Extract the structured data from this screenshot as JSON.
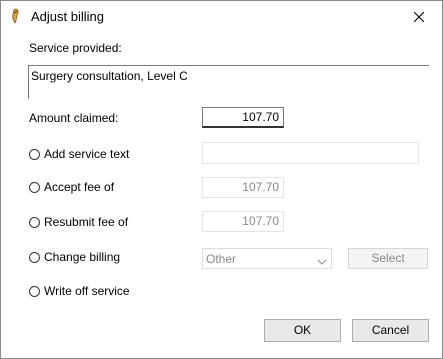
{
  "window": {
    "title": "Adjust billing"
  },
  "service": {
    "label": "Service provided:",
    "value": "Surgery consultation, Level C"
  },
  "amount": {
    "label": "Amount claimed:",
    "value": "107.70"
  },
  "options": {
    "add_text_label": "Add service text",
    "add_text_value": "",
    "accept_label": "Accept fee of",
    "accept_value": "107.70",
    "resubmit_label": "Resubmit fee of",
    "resubmit_value": "107.70",
    "change_label": "Change billing",
    "change_dropdown_value": "Other",
    "select_label": "Select",
    "writeoff_label": "Write off service"
  },
  "footer": {
    "ok_label": "OK",
    "cancel_label": "Cancel"
  },
  "colors": {
    "disabled_text": "#8a8a8a",
    "border": "#7a7a7a",
    "button_bg": "#e9e9e9"
  },
  "icons": [
    "app-icon",
    "close-icon",
    "chevron-down-icon"
  ]
}
